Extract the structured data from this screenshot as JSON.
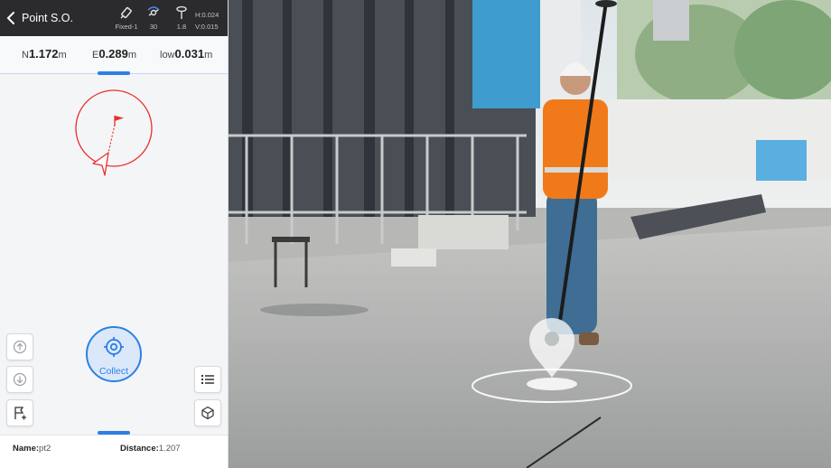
{
  "topbar": {
    "title": "Point S.O.",
    "solution_label": "Fixed-1",
    "satellites": "30",
    "antenna_height": "1.8",
    "h_precision": "H:0.024",
    "v_precision": "V:0.015"
  },
  "coordinates": {
    "north_key": "N",
    "north_value": "1.172",
    "north_unit": "m",
    "east_key": "E",
    "east_value": "0.289",
    "east_unit": "m",
    "elev_key": "low",
    "elev_value": "0.031",
    "elev_unit": "m"
  },
  "collect": {
    "label": "Collect"
  },
  "info": {
    "name_key": "Name:",
    "name_value": "pt2",
    "distance_key": "Distance:",
    "distance_value": "1.207"
  },
  "icons": [
    "back-arrow-icon",
    "gnss-signal-icon",
    "satellite-icon",
    "antenna-pole-icon",
    "target-flag-icon",
    "navigation-arrow-icon",
    "arrow-up-icon",
    "arrow-down-icon",
    "point-list-icon",
    "route-flag-icon",
    "cube-3d-icon",
    "crosshair-icon",
    "location-pin-icon"
  ],
  "colors": {
    "accent": "#2d7fe6",
    "target": "#e8302a",
    "topbar": "#2b2b2e",
    "vest": "#f07a1a"
  }
}
